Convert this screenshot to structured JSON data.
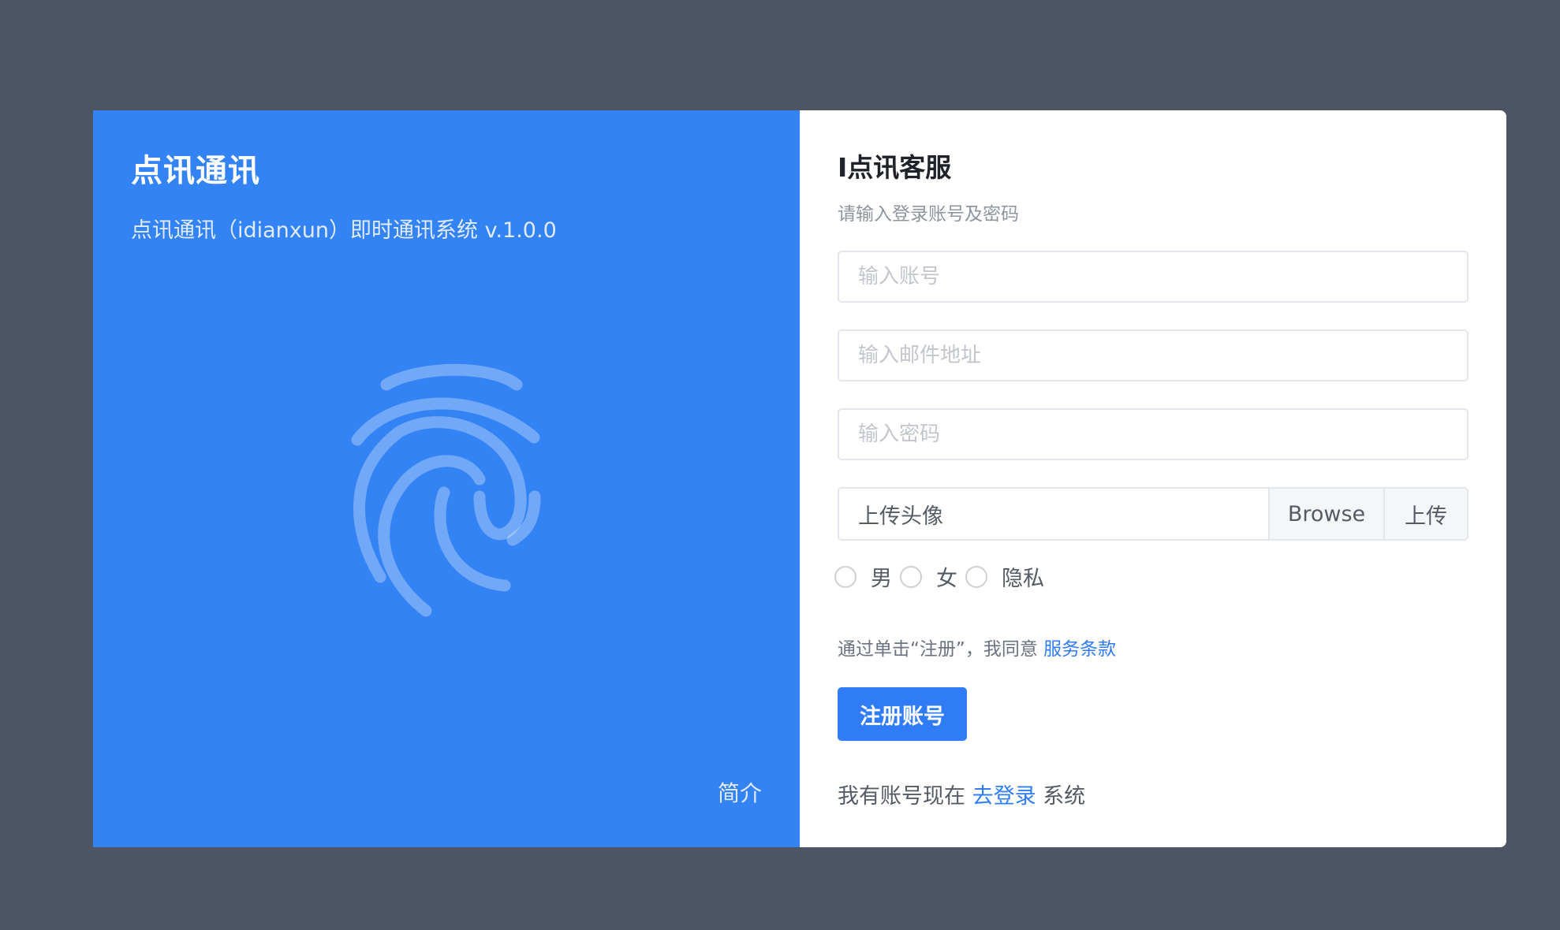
{
  "brand": {
    "title": "点讯通讯",
    "subtitle": "点讯通讯（idianxun）即时通讯系统 v.1.0.0",
    "intro_link": "简介"
  },
  "form": {
    "title": "I点讯客服",
    "subtitle": "请输入登录账号及密码",
    "account_placeholder": "输入账号",
    "email_placeholder": "输入邮件地址",
    "password_placeholder": "输入密码",
    "avatar_label": "上传头像",
    "browse_label": "Browse",
    "upload_label": "上传",
    "gender_options": [
      "男",
      "女",
      "隐私"
    ],
    "terms_text": "通过单击“注册”，我同意",
    "terms_link": "服务条款",
    "register_button": "注册账号",
    "login_prefix": "我有账号现在",
    "login_link": "去登录",
    "login_suffix": "系统"
  },
  "colors": {
    "background": "#4d5564",
    "brand_panel": "#3483f5",
    "accent": "#2f7cf6"
  },
  "icons": {
    "brand_graphic": "fingerprint-icon"
  }
}
